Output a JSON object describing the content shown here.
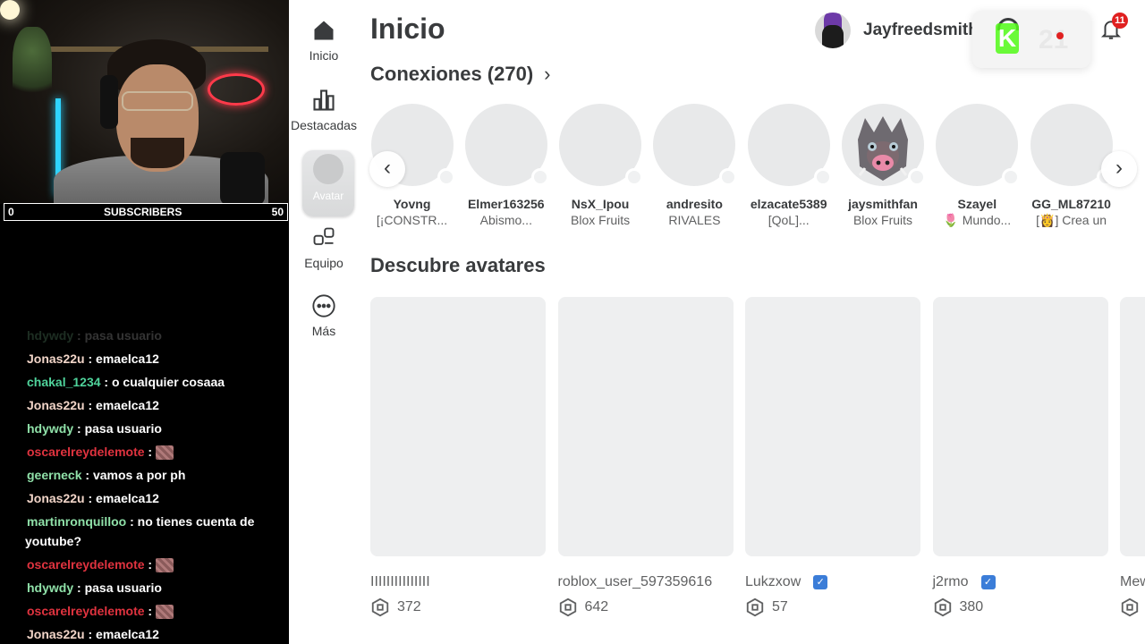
{
  "stream": {
    "subscribers": {
      "label": "SUBSCRIBERS",
      "current": "0",
      "goal": "50"
    },
    "chat": [
      {
        "user": "hdywdy",
        "color": "#8fe0a8",
        "text": "pasa usuario",
        "faded": true
      },
      {
        "user": "Jonas22u",
        "color": "#f2d5c8",
        "text": "emaelca12"
      },
      {
        "user": "chakal_1234",
        "color": "#4fd39b",
        "text": "o cualquier cosaaa"
      },
      {
        "user": "Jonas22u",
        "color": "#f2d5c8",
        "text": "emaelca12"
      },
      {
        "user": "hdywdy",
        "color": "#8fe0a8",
        "text": "pasa usuario"
      },
      {
        "user": "oscarelreydelemote",
        "color": "#e0333f",
        "text": "",
        "emote": true
      },
      {
        "user": "geerneck",
        "color": "#8fe0a8",
        "text": "vamos a por ph"
      },
      {
        "user": "Jonas22u",
        "color": "#f2d5c8",
        "text": "emaelca12"
      },
      {
        "user": "martinronquilloo",
        "color": "#8fe0a8",
        "text": "no tienes cuenta de",
        "cont": "youtube?"
      },
      {
        "user": "oscarelreydelemote",
        "color": "#e0333f",
        "text": "",
        "emote": true
      },
      {
        "user": "hdywdy",
        "color": "#8fe0a8",
        "text": "pasa usuario"
      },
      {
        "user": "oscarelreydelemote",
        "color": "#e0333f",
        "text": "",
        "emote": true
      },
      {
        "user": "Jonas22u",
        "color": "#f2d5c8",
        "text": "emaelca12"
      }
    ]
  },
  "nav": {
    "home": "Inicio",
    "featured": "Destacadas",
    "avatar": "Avatar",
    "team": "Equipo",
    "more": "Más"
  },
  "header": {
    "title": "Inicio",
    "username": "Jayfreedsmith",
    "ext_number": "21",
    "notifications": "11"
  },
  "connections": {
    "title": "Conexiones (270)",
    "friends": [
      {
        "name": "Yovng",
        "sub": "[¡CONSTR..."
      },
      {
        "name": "Elmer163256",
        "sub": "Abismo..."
      },
      {
        "name": "NsX_Ipou",
        "sub": "Blox Fruits"
      },
      {
        "name": "andresito",
        "sub": "RIVALES"
      },
      {
        "name": "elzacate5389",
        "sub": "[QoL]..."
      },
      {
        "name": "jaysmithfan",
        "sub": "Blox Fruits"
      },
      {
        "name": "Szayel",
        "sub": "🌷 Mundo..."
      },
      {
        "name": "GG_ML87210",
        "sub": "[👸] Crea un"
      }
    ]
  },
  "discover": {
    "title": "Descubre avatares",
    "avatars": [
      {
        "name": "IIIIIIIIIIIIIII",
        "price": "372",
        "verified": false
      },
      {
        "name": "roblox_user_597359616",
        "price": "642",
        "verified": false
      },
      {
        "name": "Lukzxow",
        "price": "57",
        "verified": true
      },
      {
        "name": "j2rmo",
        "price": "380",
        "verified": true
      },
      {
        "name": "Mew",
        "price": "",
        "verified": false
      }
    ]
  }
}
